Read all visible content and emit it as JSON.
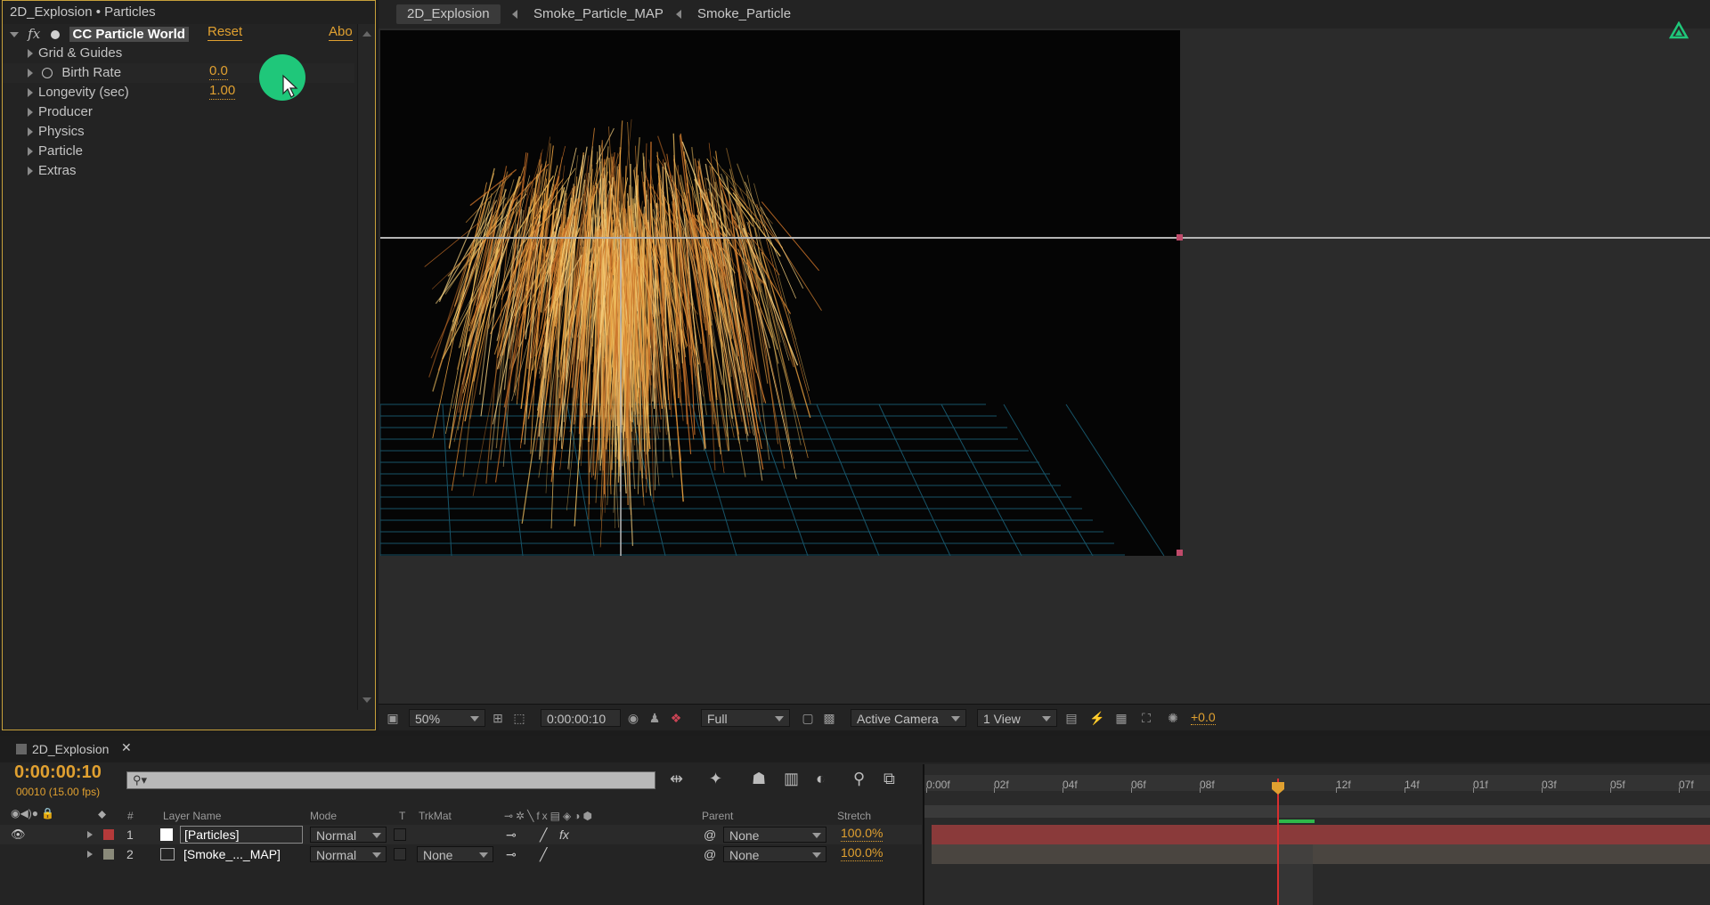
{
  "effect_panel": {
    "title": "2D_Explosion • Particles",
    "fx_label": "fx",
    "effect_name": "CC Particle World",
    "reset_label": "Reset",
    "about_label": "Abo",
    "properties": [
      {
        "label": "Grid & Guides"
      },
      {
        "label": "Birth Rate",
        "value": "0.0"
      },
      {
        "label": "Longevity (sec)",
        "value": "1.00"
      },
      {
        "label": "Producer"
      },
      {
        "label": "Physics"
      },
      {
        "label": "Particle"
      },
      {
        "label": "Extras"
      }
    ]
  },
  "viewer": {
    "breadcrumbs": [
      "2D_Explosion",
      "Smoke_Particle_MAP",
      "Smoke_Particle"
    ],
    "zoom": "50%",
    "timecode": "0:00:00:10",
    "resolution": "Full",
    "camera": "Active Camera",
    "views": "1 View",
    "exposure": "+0.0"
  },
  "timeline": {
    "tab": "2D_Explosion",
    "current_time": "0:00:00:10",
    "frame_info": "00010 (15.00 fps)",
    "search_icon": "search-icon",
    "columns": {
      "num": "#",
      "layer_name": "Layer Name",
      "mode": "Mode",
      "t": "T",
      "trkmat": "TrkMat",
      "parent": "Parent",
      "stretch": "Stretch"
    },
    "ruler_labels": [
      "0:00f",
      "02f",
      "04f",
      "06f",
      "08f",
      "12f",
      "14f",
      "01f",
      "03f",
      "05f",
      "07f"
    ],
    "layers": [
      {
        "num": "1",
        "name": "[Particles]",
        "mode": "Normal",
        "trkmat": "",
        "parent": "None",
        "stretch": "100.0%",
        "color": "#b53a3a"
      },
      {
        "num": "2",
        "name": "[Smoke_..._MAP]",
        "mode": "Normal",
        "trkmat": "None",
        "parent": "None",
        "stretch": "100.0%",
        "color": "#8a8a7a"
      }
    ]
  },
  "colors": {
    "accent": "#e0a030",
    "panel_border": "#c7a03a",
    "cursor_circle": "#1fc77a",
    "layer1_bar": "#8a3a3a",
    "playhead": "#d83030"
  }
}
